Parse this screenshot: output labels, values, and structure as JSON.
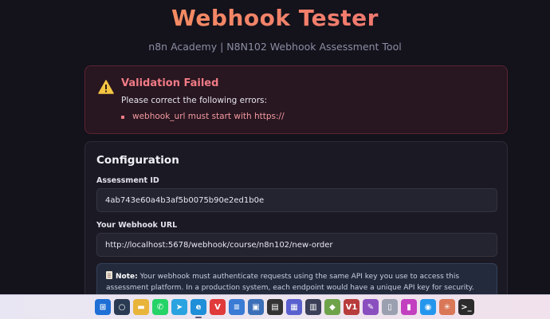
{
  "header": {
    "title": "Webhook Tester",
    "subtitle": "n8n Academy | N8N102 Webhook Assessment Tool"
  },
  "alert": {
    "title": "Validation Failed",
    "description": "Please correct the following errors:",
    "errors": [
      "webhook_url must start with https://"
    ],
    "color": "#f07b86"
  },
  "config": {
    "title": "Configuration",
    "assessment_id_label": "Assessment ID",
    "assessment_id_value": "4ab743e60a4b3af5b0075b90e2ed1b0e",
    "webhook_url_label": "Your Webhook URL",
    "webhook_url_value": "http://localhost:5678/webhook/course/n8n102/new-order",
    "note_label": "Note:",
    "note_text": " Your webhook must authenticate requests using the same API key you use to access this assessment platform. In a production system, each endpoint would have a unique API key for security."
  },
  "taskbar": {
    "icons": [
      {
        "name": "windows-start-icon",
        "color": "#1f6fd6",
        "glyph": "⊞"
      },
      {
        "name": "search-icon",
        "color": "#2a3a52",
        "glyph": "○"
      },
      {
        "name": "file-explorer-icon",
        "color": "#e8b43a",
        "glyph": "▬"
      },
      {
        "name": "whatsapp-icon",
        "color": "#25d366",
        "glyph": "✆"
      },
      {
        "name": "telegram-icon",
        "color": "#2aa3e0",
        "glyph": "➤"
      },
      {
        "name": "edge-browser-icon",
        "color": "#1e8fd8",
        "glyph": "e"
      },
      {
        "name": "vivaldi-icon",
        "color": "#e03a3a",
        "glyph": "V"
      },
      {
        "name": "notepad-icon",
        "color": "#3a7bd5",
        "glyph": "≡"
      },
      {
        "name": "photos-icon",
        "color": "#3b6fb8",
        "glyph": "▣"
      },
      {
        "name": "clapper-icon",
        "color": "#333333",
        "glyph": "▤"
      },
      {
        "name": "files-icon",
        "color": "#5a5fcf",
        "glyph": "▦"
      },
      {
        "name": "calculator-icon",
        "color": "#3b3f58",
        "glyph": "▥"
      },
      {
        "name": "android-icon",
        "color": "#6fa34a",
        "glyph": "◆"
      },
      {
        "name": "v1-app-icon",
        "color": "#b83c3c",
        "glyph": "V1"
      },
      {
        "name": "paint-icon",
        "color": "#8a4fbf",
        "glyph": "✎"
      },
      {
        "name": "document-icon",
        "color": "#9aa0b0",
        "glyph": "▯"
      },
      {
        "name": "purple-app-icon",
        "color": "#c23fc0",
        "glyph": "▮"
      },
      {
        "name": "docker-icon",
        "color": "#2496ed",
        "glyph": "◉"
      },
      {
        "name": "claude-icon",
        "color": "#d97757",
        "glyph": "✳"
      },
      {
        "name": "terminal-icon",
        "color": "#2b2b2b",
        "glyph": ">_"
      }
    ]
  }
}
